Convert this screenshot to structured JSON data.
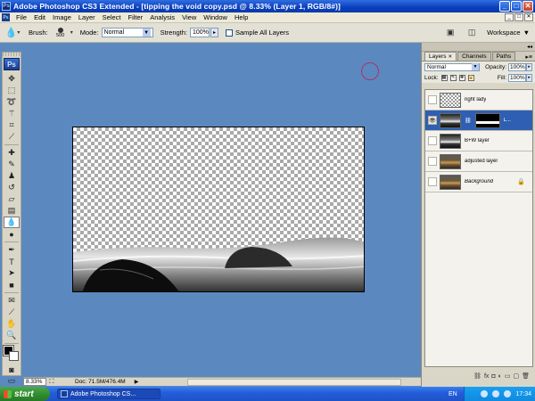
{
  "window": {
    "app_icon": "Ps",
    "title": "Adobe Photoshop CS3 Extended - [tipping the void copy.psd @ 8.33% (Layer 1, RGB/8#)]",
    "buttons": [
      "_",
      "□",
      "✕"
    ]
  },
  "menubar": {
    "items": [
      "File",
      "Edit",
      "Image",
      "Layer",
      "Select",
      "Filter",
      "Analysis",
      "View",
      "Window",
      "Help"
    ]
  },
  "options": {
    "brush_label": "Brush:",
    "brush_size": "500",
    "mode_label": "Mode:",
    "mode_value": "Normal",
    "strength_label": "Strength:",
    "strength_value": "100%",
    "sample_all_layers": "Sample All Layers",
    "workspace": "Workspace"
  },
  "tools": {
    "logo": "Ps",
    "icons": [
      "move-icon",
      "marquee-icon",
      "lasso-icon",
      "magic-wand-icon",
      "crop-icon",
      "slice-icon",
      "healing-brush-icon",
      "brush-icon",
      "clone-stamp-icon",
      "history-brush-icon",
      "eraser-icon",
      "gradient-icon",
      "blur-icon",
      "dodge-icon",
      "pen-icon",
      "type-icon",
      "path-selection-icon",
      "shape-icon",
      "notes-icon",
      "eyedropper-icon",
      "hand-icon",
      "zoom-icon"
    ],
    "active_tool": "blur-icon"
  },
  "status": {
    "zoom": "8.33%",
    "doc": "Doc: 71.5M/476.4M"
  },
  "panels": {
    "tabs": [
      "Layers",
      "Channels",
      "Paths"
    ],
    "blend_mode": "Normal",
    "opacity_label": "Opacity:",
    "opacity_value": "100%",
    "lock_label": "Lock:",
    "fill_label": "Fill:",
    "fill_value": "100%",
    "layers": [
      {
        "name": "right lady",
        "visible": false,
        "selected": false,
        "thumb": "checker"
      },
      {
        "name": "L...",
        "visible": true,
        "selected": true,
        "thumb": "bw",
        "has_mask": true
      },
      {
        "name": "B+W layer",
        "visible": false,
        "selected": false,
        "thumb": "bw"
      },
      {
        "name": "adjusted layer",
        "visible": false,
        "selected": false,
        "thumb": "color"
      },
      {
        "name": "Background",
        "visible": false,
        "selected": false,
        "thumb": "color",
        "locked": true
      }
    ]
  },
  "taskbar": {
    "start": "start",
    "item": "Adobe Photoshop CS...",
    "lang": "EN",
    "clock": "17:34"
  }
}
